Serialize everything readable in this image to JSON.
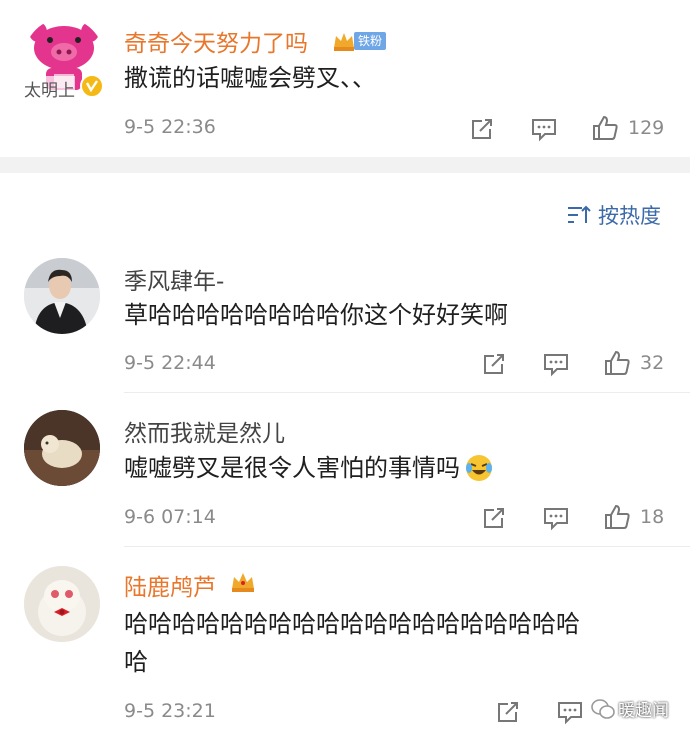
{
  "top_comment": {
    "avatar_label": "太明上",
    "username": "奇奇今天努力了吗",
    "fan_badge": "铁粉",
    "text": "撒谎的话嘘嘘会劈叉、、",
    "time": "9-5 22:36",
    "likes": "129"
  },
  "sort": {
    "label": "按热度"
  },
  "comments": [
    {
      "username": "季风肆年-",
      "text": "草哈哈哈哈哈哈哈哈你这个好好笑啊",
      "time": "9-5 22:44",
      "likes": "32"
    },
    {
      "username": "然而我就是然儿",
      "text": "嘘嘘劈叉是很令人害怕的事情吗",
      "time": "9-6 07:14",
      "likes": "18"
    },
    {
      "username": "陆鹿鸬芦",
      "text_line1": "哈哈哈哈哈哈哈哈哈哈哈哈哈哈哈哈哈哈哈",
      "text_line2": "哈",
      "time": "9-5 23:21"
    }
  ],
  "watermark": "暖趣闻",
  "colors": {
    "vip_name": "#e8762b",
    "normal_name": "#444444",
    "sort_blue": "#3c6aa8"
  }
}
